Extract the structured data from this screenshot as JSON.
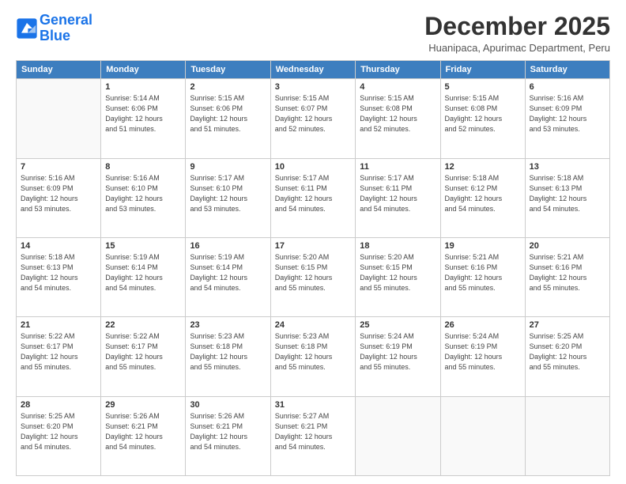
{
  "logo": {
    "line1": "General",
    "line2": "Blue"
  },
  "title": "December 2025",
  "subtitle": "Huanipaca, Apurimac Department, Peru",
  "weekdays": [
    "Sunday",
    "Monday",
    "Tuesday",
    "Wednesday",
    "Thursday",
    "Friday",
    "Saturday"
  ],
  "weeks": [
    [
      {
        "day": "",
        "sunrise": "",
        "sunset": "",
        "daylight": ""
      },
      {
        "day": "1",
        "sunrise": "Sunrise: 5:14 AM",
        "sunset": "Sunset: 6:06 PM",
        "daylight": "Daylight: 12 hours and 51 minutes."
      },
      {
        "day": "2",
        "sunrise": "Sunrise: 5:15 AM",
        "sunset": "Sunset: 6:06 PM",
        "daylight": "Daylight: 12 hours and 51 minutes."
      },
      {
        "day": "3",
        "sunrise": "Sunrise: 5:15 AM",
        "sunset": "Sunset: 6:07 PM",
        "daylight": "Daylight: 12 hours and 52 minutes."
      },
      {
        "day": "4",
        "sunrise": "Sunrise: 5:15 AM",
        "sunset": "Sunset: 6:08 PM",
        "daylight": "Daylight: 12 hours and 52 minutes."
      },
      {
        "day": "5",
        "sunrise": "Sunrise: 5:15 AM",
        "sunset": "Sunset: 6:08 PM",
        "daylight": "Daylight: 12 hours and 52 minutes."
      },
      {
        "day": "6",
        "sunrise": "Sunrise: 5:16 AM",
        "sunset": "Sunset: 6:09 PM",
        "daylight": "Daylight: 12 hours and 53 minutes."
      }
    ],
    [
      {
        "day": "7",
        "sunrise": "Sunrise: 5:16 AM",
        "sunset": "Sunset: 6:09 PM",
        "daylight": "Daylight: 12 hours and 53 minutes."
      },
      {
        "day": "8",
        "sunrise": "Sunrise: 5:16 AM",
        "sunset": "Sunset: 6:10 PM",
        "daylight": "Daylight: 12 hours and 53 minutes."
      },
      {
        "day": "9",
        "sunrise": "Sunrise: 5:17 AM",
        "sunset": "Sunset: 6:10 PM",
        "daylight": "Daylight: 12 hours and 53 minutes."
      },
      {
        "day": "10",
        "sunrise": "Sunrise: 5:17 AM",
        "sunset": "Sunset: 6:11 PM",
        "daylight": "Daylight: 12 hours and 54 minutes."
      },
      {
        "day": "11",
        "sunrise": "Sunrise: 5:17 AM",
        "sunset": "Sunset: 6:11 PM",
        "daylight": "Daylight: 12 hours and 54 minutes."
      },
      {
        "day": "12",
        "sunrise": "Sunrise: 5:18 AM",
        "sunset": "Sunset: 6:12 PM",
        "daylight": "Daylight: 12 hours and 54 minutes."
      },
      {
        "day": "13",
        "sunrise": "Sunrise: 5:18 AM",
        "sunset": "Sunset: 6:13 PM",
        "daylight": "Daylight: 12 hours and 54 minutes."
      }
    ],
    [
      {
        "day": "14",
        "sunrise": "Sunrise: 5:18 AM",
        "sunset": "Sunset: 6:13 PM",
        "daylight": "Daylight: 12 hours and 54 minutes."
      },
      {
        "day": "15",
        "sunrise": "Sunrise: 5:19 AM",
        "sunset": "Sunset: 6:14 PM",
        "daylight": "Daylight: 12 hours and 54 minutes."
      },
      {
        "day": "16",
        "sunrise": "Sunrise: 5:19 AM",
        "sunset": "Sunset: 6:14 PM",
        "daylight": "Daylight: 12 hours and 54 minutes."
      },
      {
        "day": "17",
        "sunrise": "Sunrise: 5:20 AM",
        "sunset": "Sunset: 6:15 PM",
        "daylight": "Daylight: 12 hours and 55 minutes."
      },
      {
        "day": "18",
        "sunrise": "Sunrise: 5:20 AM",
        "sunset": "Sunset: 6:15 PM",
        "daylight": "Daylight: 12 hours and 55 minutes."
      },
      {
        "day": "19",
        "sunrise": "Sunrise: 5:21 AM",
        "sunset": "Sunset: 6:16 PM",
        "daylight": "Daylight: 12 hours and 55 minutes."
      },
      {
        "day": "20",
        "sunrise": "Sunrise: 5:21 AM",
        "sunset": "Sunset: 6:16 PM",
        "daylight": "Daylight: 12 hours and 55 minutes."
      }
    ],
    [
      {
        "day": "21",
        "sunrise": "Sunrise: 5:22 AM",
        "sunset": "Sunset: 6:17 PM",
        "daylight": "Daylight: 12 hours and 55 minutes."
      },
      {
        "day": "22",
        "sunrise": "Sunrise: 5:22 AM",
        "sunset": "Sunset: 6:17 PM",
        "daylight": "Daylight: 12 hours and 55 minutes."
      },
      {
        "day": "23",
        "sunrise": "Sunrise: 5:23 AM",
        "sunset": "Sunset: 6:18 PM",
        "daylight": "Daylight: 12 hours and 55 minutes."
      },
      {
        "day": "24",
        "sunrise": "Sunrise: 5:23 AM",
        "sunset": "Sunset: 6:18 PM",
        "daylight": "Daylight: 12 hours and 55 minutes."
      },
      {
        "day": "25",
        "sunrise": "Sunrise: 5:24 AM",
        "sunset": "Sunset: 6:19 PM",
        "daylight": "Daylight: 12 hours and 55 minutes."
      },
      {
        "day": "26",
        "sunrise": "Sunrise: 5:24 AM",
        "sunset": "Sunset: 6:19 PM",
        "daylight": "Daylight: 12 hours and 55 minutes."
      },
      {
        "day": "27",
        "sunrise": "Sunrise: 5:25 AM",
        "sunset": "Sunset: 6:20 PM",
        "daylight": "Daylight: 12 hours and 55 minutes."
      }
    ],
    [
      {
        "day": "28",
        "sunrise": "Sunrise: 5:25 AM",
        "sunset": "Sunset: 6:20 PM",
        "daylight": "Daylight: 12 hours and 54 minutes."
      },
      {
        "day": "29",
        "sunrise": "Sunrise: 5:26 AM",
        "sunset": "Sunset: 6:21 PM",
        "daylight": "Daylight: 12 hours and 54 minutes."
      },
      {
        "day": "30",
        "sunrise": "Sunrise: 5:26 AM",
        "sunset": "Sunset: 6:21 PM",
        "daylight": "Daylight: 12 hours and 54 minutes."
      },
      {
        "day": "31",
        "sunrise": "Sunrise: 5:27 AM",
        "sunset": "Sunset: 6:21 PM",
        "daylight": "Daylight: 12 hours and 54 minutes."
      },
      {
        "day": "",
        "sunrise": "",
        "sunset": "",
        "daylight": ""
      },
      {
        "day": "",
        "sunrise": "",
        "sunset": "",
        "daylight": ""
      },
      {
        "day": "",
        "sunrise": "",
        "sunset": "",
        "daylight": ""
      }
    ]
  ]
}
